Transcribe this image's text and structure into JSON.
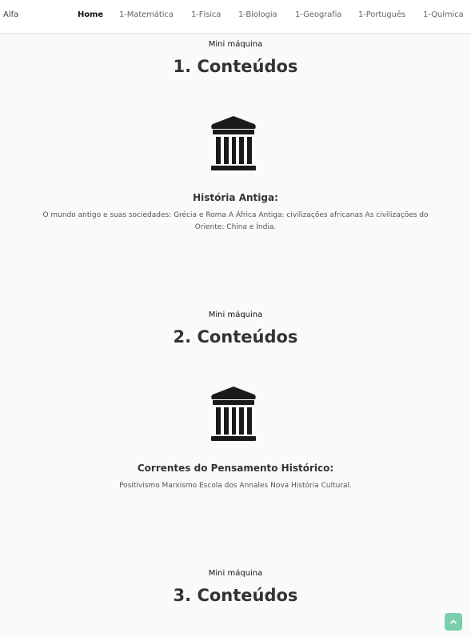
{
  "nav": {
    "brand": "Alfa",
    "links": [
      {
        "label": "Home",
        "active": true
      },
      {
        "label": "1-Matemática"
      },
      {
        "label": "1-Física"
      },
      {
        "label": "1-Biologia"
      },
      {
        "label": "1-Geografia"
      },
      {
        "label": "1-Português"
      },
      {
        "label": "1-Química"
      }
    ]
  },
  "sections": [
    {
      "eyebrow": "Mini máquina",
      "title": "1. Conteúdos",
      "icon": "bank-columns-icon",
      "item_title": "História Antiga:",
      "item_desc": "O mundo antigo e suas sociedades: Grécia e Roma A África Antiga: civilizações africanas As civilizações do Oriente: China e Índia."
    },
    {
      "eyebrow": "Mini máquina",
      "title": "2. Conteúdos",
      "icon": "bank-columns-icon",
      "item_title": "Correntes do Pensamento Histórico:",
      "item_desc": "Positivismo Marxismo Escola dos Annales Nova História Cultural."
    },
    {
      "eyebrow": "Mini máquina",
      "title": "3. Conteúdos"
    }
  ],
  "back_to_top": {
    "icon": "chevron-up-icon",
    "color": "#7ccfac"
  }
}
